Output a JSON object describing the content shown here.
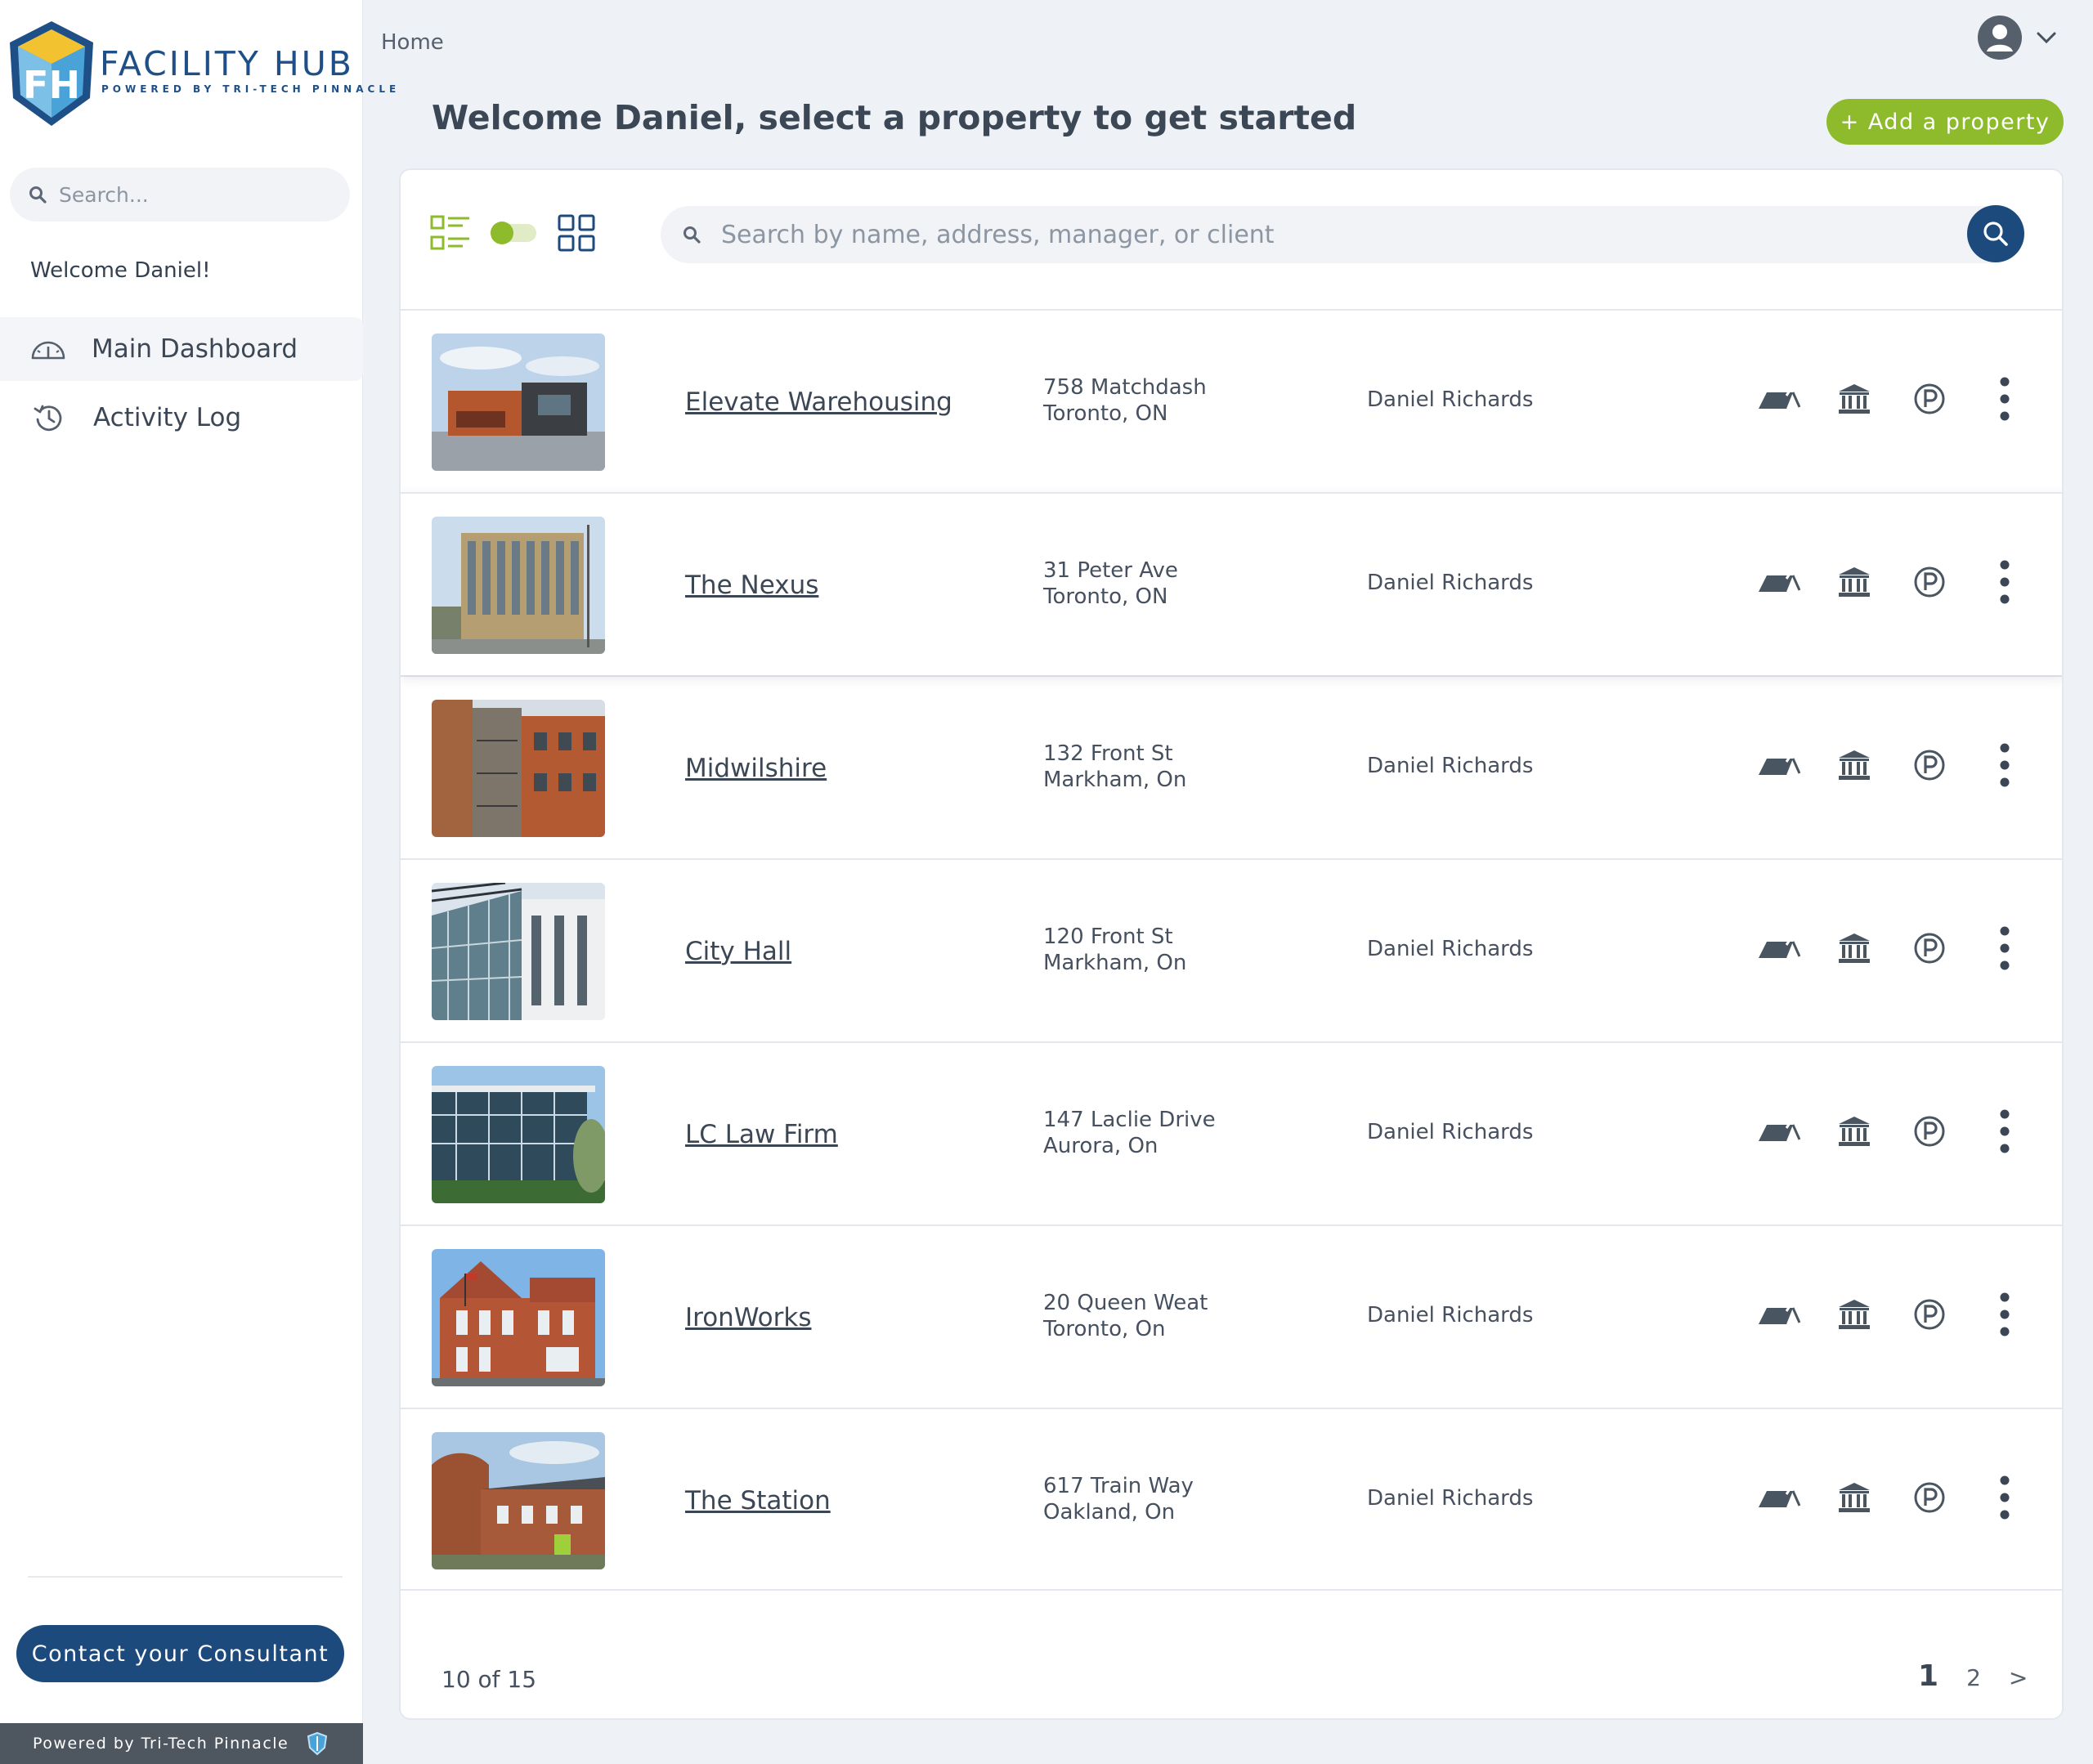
{
  "brand": {
    "name": "FACILITY HUB",
    "tagline": "POWERED BY TRI-TECH PINNACLE",
    "logo_letters": "FH",
    "colors": {
      "primary": "#1c4a7d",
      "accent": "#8dbb2b"
    }
  },
  "sidebar": {
    "search_placeholder": "Search...",
    "welcome": "Welcome Daniel!",
    "nav": [
      {
        "label": "Main Dashboard",
        "icon": "gauge-icon",
        "active": true
      },
      {
        "label": "Activity Log",
        "icon": "history-icon",
        "active": false
      }
    ],
    "contact_button": "Contact your Consultant",
    "footer": "Powered by Tri-Tech Pinnacle"
  },
  "header": {
    "breadcrumb": "Home",
    "title": "Welcome Daniel, select a property to get started",
    "add_button": "+ Add a property"
  },
  "toolbar": {
    "search_placeholder": "Search by name, address, manager, or client",
    "view_mode": "list"
  },
  "properties": [
    {
      "name": "Elevate Warehousing",
      "address_line1": "758 Matchdash",
      "address_line2": "Toronto, ON",
      "manager": "Daniel Richards"
    },
    {
      "name": "The Nexus",
      "address_line1": "31 Peter Ave",
      "address_line2": "Toronto, ON",
      "manager": "Daniel Richards"
    },
    {
      "name": "Midwilshire",
      "address_line1": "132 Front St",
      "address_line2": "Markham, On",
      "manager": "Daniel Richards"
    },
    {
      "name": "City Hall",
      "address_line1": "120 Front St",
      "address_line2": "Markham, On",
      "manager": "Daniel Richards"
    },
    {
      "name": "LC Law Firm",
      "address_line1": "147 Laclie Drive",
      "address_line2": "Aurora, On",
      "manager": "Daniel Richards"
    },
    {
      "name": "IronWorks",
      "address_line1": "20 Queen Weat",
      "address_line2": "Toronto, On",
      "manager": "Daniel Richards"
    },
    {
      "name": "The Station",
      "address_line1": "617 Train Way",
      "address_line2": "Oakland, On",
      "manager": "Daniel Richards"
    }
  ],
  "pagination": {
    "count_text": "10 of 15",
    "pages": [
      "1",
      "2"
    ],
    "current": "1",
    "next": ">"
  }
}
